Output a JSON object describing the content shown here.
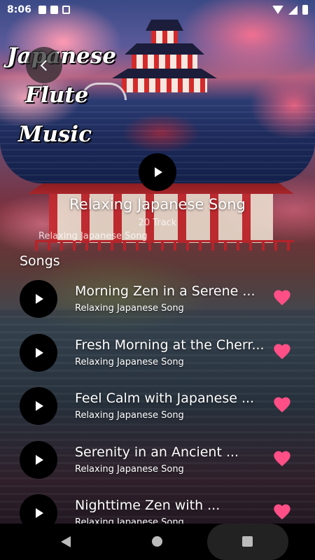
{
  "status_bar": {
    "time": "8:06"
  },
  "header": {
    "title_lines": [
      "Japanese",
      "Flute",
      "Music"
    ]
  },
  "album": {
    "title": "Relaxing Japanese Song",
    "track_count": "20 Track",
    "subtitle": "Relaxing Japanese Song"
  },
  "section": {
    "heading": "Songs"
  },
  "songs": [
    {
      "title": "Morning Zen in a Serene ...",
      "artist": "Relaxing Japanese Song",
      "favorite": true
    },
    {
      "title": "Fresh Morning at the Cherr...",
      "artist": "Relaxing Japanese Song",
      "favorite": true
    },
    {
      "title": "Feel Calm with Japanese ...",
      "artist": "Relaxing Japanese Song",
      "favorite": true
    },
    {
      "title": "Serenity in an Ancient ...",
      "artist": "Relaxing Japanese Song",
      "favorite": true
    },
    {
      "title": "Nighttime Zen with ...",
      "artist": "Relaxing Japanese Song",
      "favorite": true
    }
  ],
  "colors": {
    "accent_heart": "#ff4f86",
    "play_button_bg": "#000000",
    "nav_bar_bg": "#000000"
  },
  "icons": {
    "back": "chevron-left-icon",
    "play": "play-icon",
    "favorite": "heart-icon"
  }
}
